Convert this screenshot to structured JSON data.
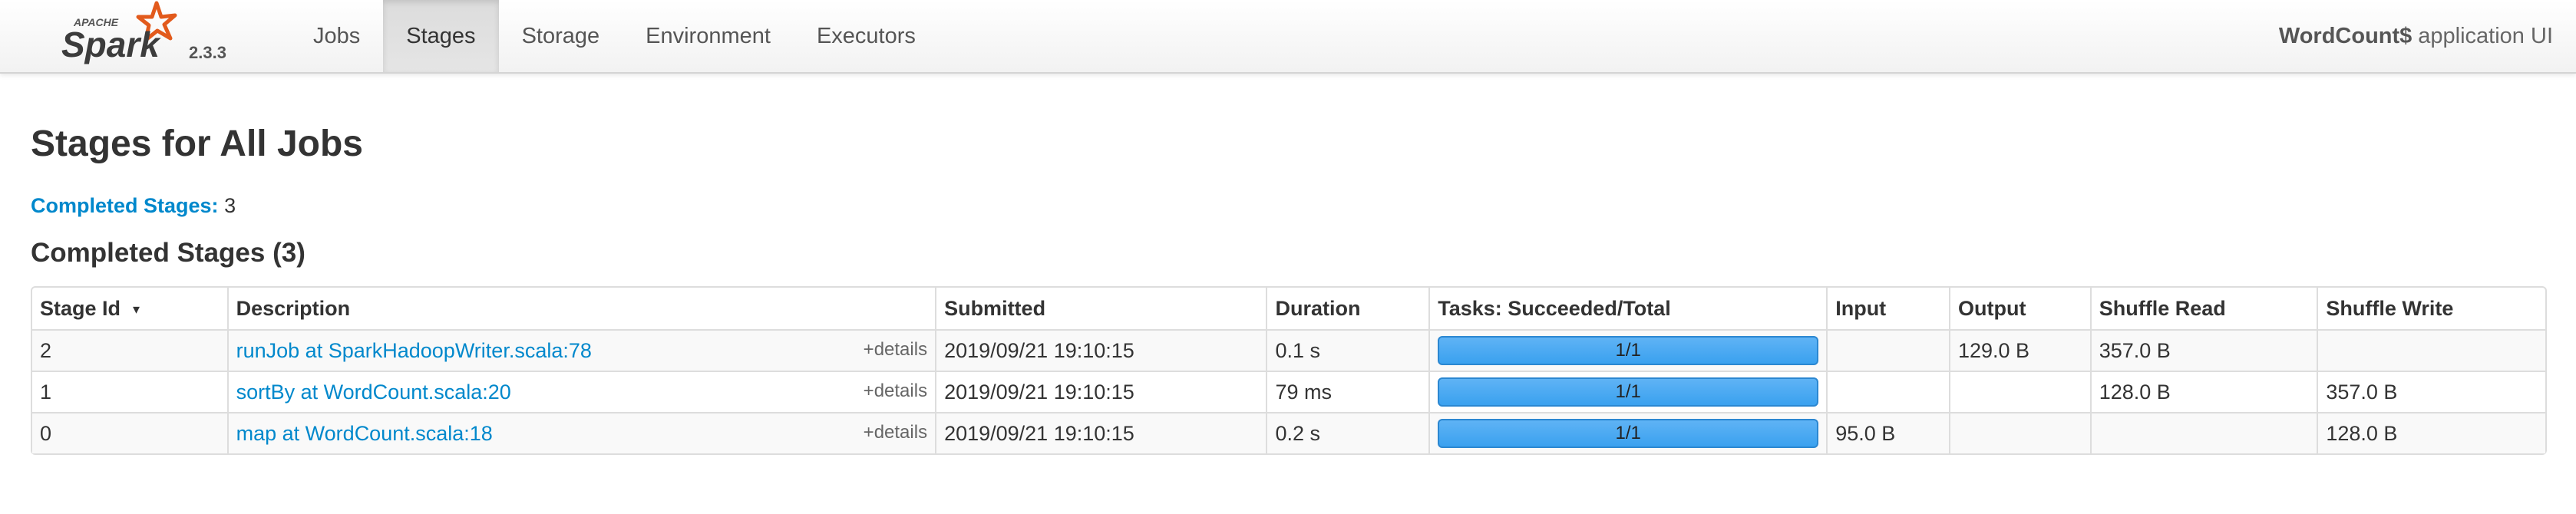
{
  "navbar": {
    "brand_top": "APACHE",
    "brand_name": "Spark",
    "version": "2.3.3",
    "tabs": [
      {
        "label": "Jobs"
      },
      {
        "label": "Stages"
      },
      {
        "label": "Storage"
      },
      {
        "label": "Environment"
      },
      {
        "label": "Executors"
      }
    ],
    "active_tab": "Stages",
    "app_name": "WordCount$",
    "app_suffix": "application UI"
  },
  "page": {
    "title": "Stages for All Jobs",
    "summary_label": "Completed Stages:",
    "summary_count": "3",
    "section_title": "Completed Stages (3)"
  },
  "table": {
    "headers": [
      "Stage Id",
      "Description",
      "Submitted",
      "Duration",
      "Tasks: Succeeded/Total",
      "Input",
      "Output",
      "Shuffle Read",
      "Shuffle Write"
    ],
    "sort_indicator": "▾",
    "details_label": "+details",
    "rows": [
      {
        "stage_id": "2",
        "description": "runJob at SparkHadoopWriter.scala:78",
        "submitted": "2019/09/21 19:10:15",
        "duration": "0.1 s",
        "tasks": "1/1",
        "input": "",
        "output": "129.0 B",
        "shuffle_read": "357.0 B",
        "shuffle_write": ""
      },
      {
        "stage_id": "1",
        "description": "sortBy at WordCount.scala:20",
        "submitted": "2019/09/21 19:10:15",
        "duration": "79 ms",
        "tasks": "1/1",
        "input": "",
        "output": "",
        "shuffle_read": "128.0 B",
        "shuffle_write": "357.0 B"
      },
      {
        "stage_id": "0",
        "description": "map at WordCount.scala:18",
        "submitted": "2019/09/21 19:10:15",
        "duration": "0.2 s",
        "tasks": "1/1",
        "input": "95.0 B",
        "output": "",
        "shuffle_read": "",
        "shuffle_write": "128.0 B"
      }
    ]
  },
  "colors": {
    "link": "#0088cc",
    "progress": "#3aa1ef",
    "logo_orange": "#e25a1c"
  }
}
